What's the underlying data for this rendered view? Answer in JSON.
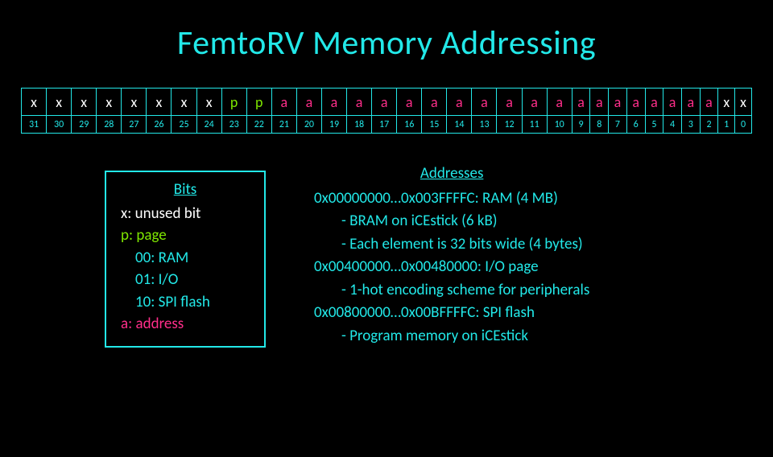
{
  "title": "FemtoRV Memory Addressing",
  "bits": [
    {
      "n": 31,
      "g": "x",
      "c": "x"
    },
    {
      "n": 30,
      "g": "x",
      "c": "x"
    },
    {
      "n": 29,
      "g": "x",
      "c": "x"
    },
    {
      "n": 28,
      "g": "x",
      "c": "x"
    },
    {
      "n": 27,
      "g": "x",
      "c": "x"
    },
    {
      "n": 26,
      "g": "x",
      "c": "x"
    },
    {
      "n": 25,
      "g": "x",
      "c": "x"
    },
    {
      "n": 24,
      "g": "x",
      "c": "x"
    },
    {
      "n": 23,
      "g": "p",
      "c": "p"
    },
    {
      "n": 22,
      "g": "p",
      "c": "p"
    },
    {
      "n": 21,
      "g": "a",
      "c": "a"
    },
    {
      "n": 20,
      "g": "a",
      "c": "a"
    },
    {
      "n": 19,
      "g": "a",
      "c": "a"
    },
    {
      "n": 18,
      "g": "a",
      "c": "a"
    },
    {
      "n": 17,
      "g": "a",
      "c": "a"
    },
    {
      "n": 16,
      "g": "a",
      "c": "a"
    },
    {
      "n": 15,
      "g": "a",
      "c": "a"
    },
    {
      "n": 14,
      "g": "a",
      "c": "a"
    },
    {
      "n": 13,
      "g": "a",
      "c": "a"
    },
    {
      "n": 12,
      "g": "a",
      "c": "a"
    },
    {
      "n": 11,
      "g": "a",
      "c": "a"
    },
    {
      "n": 10,
      "g": "a",
      "c": "a"
    },
    {
      "n": 9,
      "g": "a",
      "c": "a"
    },
    {
      "n": 8,
      "g": "a",
      "c": "a"
    },
    {
      "n": 7,
      "g": "a",
      "c": "a"
    },
    {
      "n": 6,
      "g": "a",
      "c": "a"
    },
    {
      "n": 5,
      "g": "a",
      "c": "a"
    },
    {
      "n": 4,
      "g": "a",
      "c": "a"
    },
    {
      "n": 3,
      "g": "a",
      "c": "a"
    },
    {
      "n": 2,
      "g": "a",
      "c": "a"
    },
    {
      "n": 1,
      "g": "x",
      "c": "x"
    },
    {
      "n": 0,
      "g": "x",
      "c": "x"
    }
  ],
  "legend": {
    "header": "Bits",
    "x": "x: unused bit",
    "p": "p: page",
    "p00": "00: RAM",
    "p01": "01: I/O",
    "p10": "10: SPI flash",
    "a": "a: address"
  },
  "addresses": {
    "header": "Addresses",
    "ram": "0x00000000…0x003FFFFC: RAM (4 MB)",
    "ram_sub1": "- BRAM on iCEstick (6 kB)",
    "ram_sub2": "- Each element is 32 bits wide (4 bytes)",
    "io": "0x00400000…0x00480000: I/O page",
    "io_sub1": "- 1-hot encoding scheme for peripherals",
    "spi": "0x00800000…0x00BFFFFC: SPI flash",
    "spi_sub1": "- Program memory on iCEstick"
  }
}
